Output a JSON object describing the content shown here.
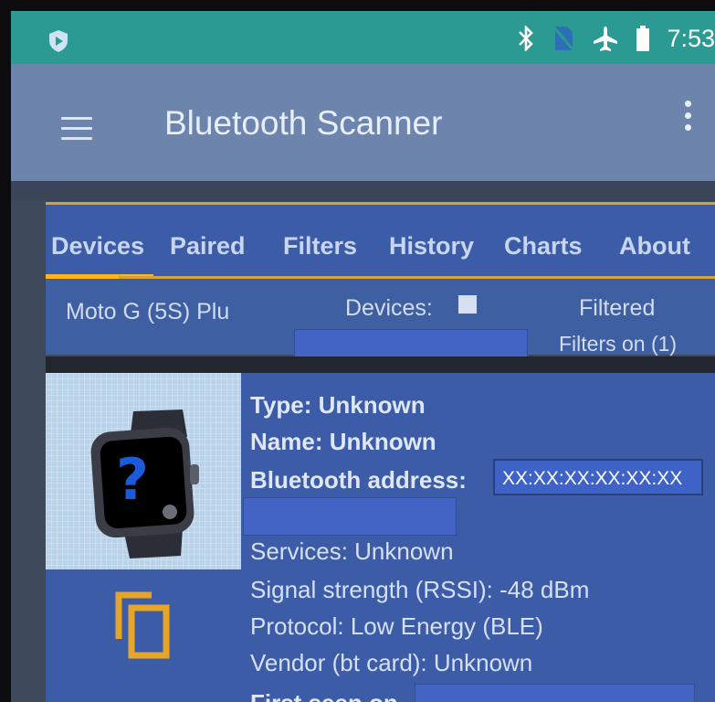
{
  "status_bar": {
    "time": "7:53",
    "icons": [
      "app-shield-icon",
      "bluetooth-icon",
      "no-sim-icon",
      "airplane-icon",
      "battery-icon"
    ]
  },
  "app_bar": {
    "title": "Bluetooth Scanner",
    "menu_icon": "hamburger-menu-icon",
    "overflow_icon": "more-vert-icon"
  },
  "tabs": [
    {
      "label": "Devices",
      "active": true
    },
    {
      "label": "Paired",
      "active": false
    },
    {
      "label": "Filters",
      "active": false
    },
    {
      "label": "History",
      "active": false
    },
    {
      "label": "Charts",
      "active": false
    },
    {
      "label": "About",
      "active": false
    }
  ],
  "info": {
    "device_model": "Moto G (5S) Plu",
    "devices_label": "Devices:",
    "filtered_label": "Filtered",
    "filters_on": "Filters on (1)"
  },
  "device_card": {
    "type": "Type: Unknown",
    "name": "Name: Unknown",
    "bt_address_label": "Bluetooth address:",
    "bt_address_value": "XX:XX:XX:XX:XX:XX",
    "services": "Services: Unknown",
    "rssi": "Signal strength (RSSI): -48 dBm",
    "protocol": "Protocol: Low Energy (BLE)",
    "vendor": "Vendor (bt card): Unknown",
    "first_seen_label": "First seen on",
    "thumbnail_icon": "smartwatch-unknown-icon",
    "copy_icon": "copy-icon"
  },
  "colors": {
    "status_bar": "#2a9a92",
    "app_bar": "#6d85ac",
    "tab_bg": "#3d5ca8",
    "accent": "#ffb41a"
  }
}
